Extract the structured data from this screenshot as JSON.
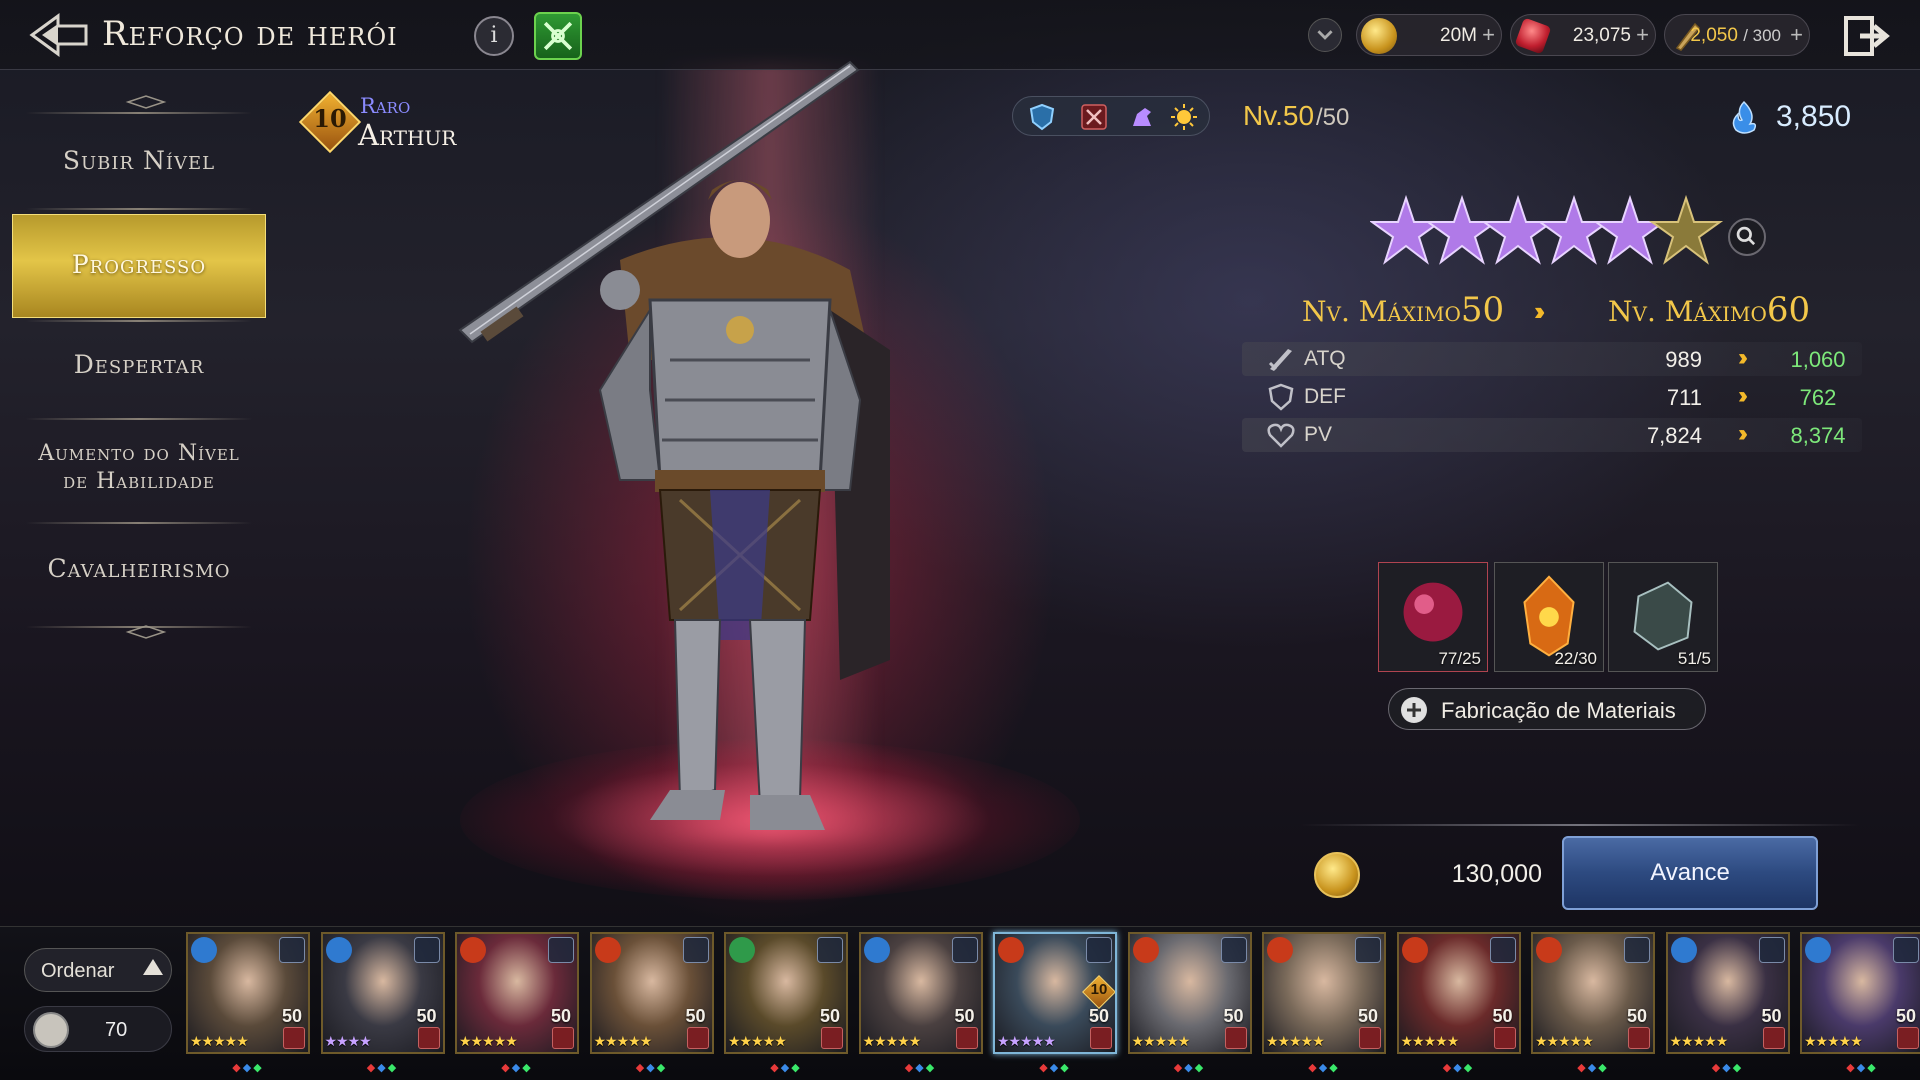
{
  "header": {
    "title": "Reforço de herói",
    "info_label": "i",
    "currencies": [
      {
        "icon": "gold-coin-icon",
        "value": "20M",
        "plus": "+"
      },
      {
        "icon": "red-gem-icon",
        "value": "23,075",
        "plus": "+"
      },
      {
        "icon": "stamina-quill-icon",
        "value": "2,050",
        "max": "/ 300",
        "plus": "+"
      }
    ]
  },
  "menu": {
    "items": [
      {
        "label": "Subir Nível",
        "active": false
      },
      {
        "label": "Progresso",
        "active": true
      },
      {
        "label": "Despertar",
        "active": false
      },
      {
        "label": "Aumento do Nível\nde Habilidade",
        "active": false
      },
      {
        "label": "Cavalheirismo",
        "active": false
      }
    ]
  },
  "hero": {
    "rank": "10",
    "rarity": "Raro",
    "name": "Arthur",
    "level_label": "Nv.",
    "level": "50",
    "level_max": "/50",
    "power": "3,850",
    "stars_purple": 5,
    "stars_gold": 1
  },
  "progress": {
    "max_label": "Nv. Máximo",
    "from": "50",
    "to": "60",
    "stats": [
      {
        "icon": "sword-icon",
        "name": "ATQ",
        "current": "989",
        "next": "1,060"
      },
      {
        "icon": "shield-icon",
        "name": "DEF",
        "current": "711",
        "next": "762"
      },
      {
        "icon": "heart-icon",
        "name": "PV",
        "current": "7,824",
        "next": "8,374"
      }
    ]
  },
  "materials": [
    {
      "icon": "red-orb-icon",
      "count": "77/25"
    },
    {
      "icon": "orange-sun-crystal-icon",
      "count": "22/30"
    },
    {
      "icon": "dark-stone-icon",
      "count": "51/5"
    }
  ],
  "fabrication_label": "Fabricação de Materiais",
  "cost": "130,000",
  "advance_label": "Avance",
  "bottom": {
    "sort_label": "Ordenar",
    "hero_count": "70",
    "cards": [
      {
        "element": "ice",
        "level": "50",
        "stars": "★★★★★",
        "star_color": "gold"
      },
      {
        "element": "ice",
        "level": "50",
        "stars": "★★★★",
        "star_color": "purple"
      },
      {
        "element": "fire",
        "level": "50",
        "stars": "★★★★★",
        "star_color": "gold"
      },
      {
        "element": "fire",
        "level": "50",
        "stars": "★★★★★",
        "star_color": "gold"
      },
      {
        "element": "nature",
        "level": "50",
        "stars": "★★★★★",
        "star_color": "gold"
      },
      {
        "element": "ice",
        "level": "50",
        "stars": "★★★★★",
        "star_color": "gold"
      },
      {
        "element": "fire",
        "level": "50",
        "stars": "★★★★★",
        "star_color": "purple",
        "rank": "10",
        "selected": true
      },
      {
        "element": "fire",
        "level": "50",
        "stars": "★★★★★",
        "star_color": "gold"
      },
      {
        "element": "fire",
        "level": "50",
        "stars": "★★★★★",
        "star_color": "gold"
      },
      {
        "element": "fire",
        "level": "50",
        "stars": "★★★★★",
        "star_color": "gold"
      },
      {
        "element": "fire",
        "level": "50",
        "stars": "★★★★★",
        "star_color": "gold"
      },
      {
        "element": "ice",
        "level": "50",
        "stars": "★★★★★",
        "star_color": "gold"
      },
      {
        "element": "ice",
        "level": "50",
        "stars": "★★★★★",
        "star_color": "gold"
      }
    ]
  },
  "colors": {
    "accent_gold": "#f2c74a",
    "stat_increase": "#7de87a",
    "rarity": "#8b8bff",
    "advance_button": "#2d4a80"
  }
}
